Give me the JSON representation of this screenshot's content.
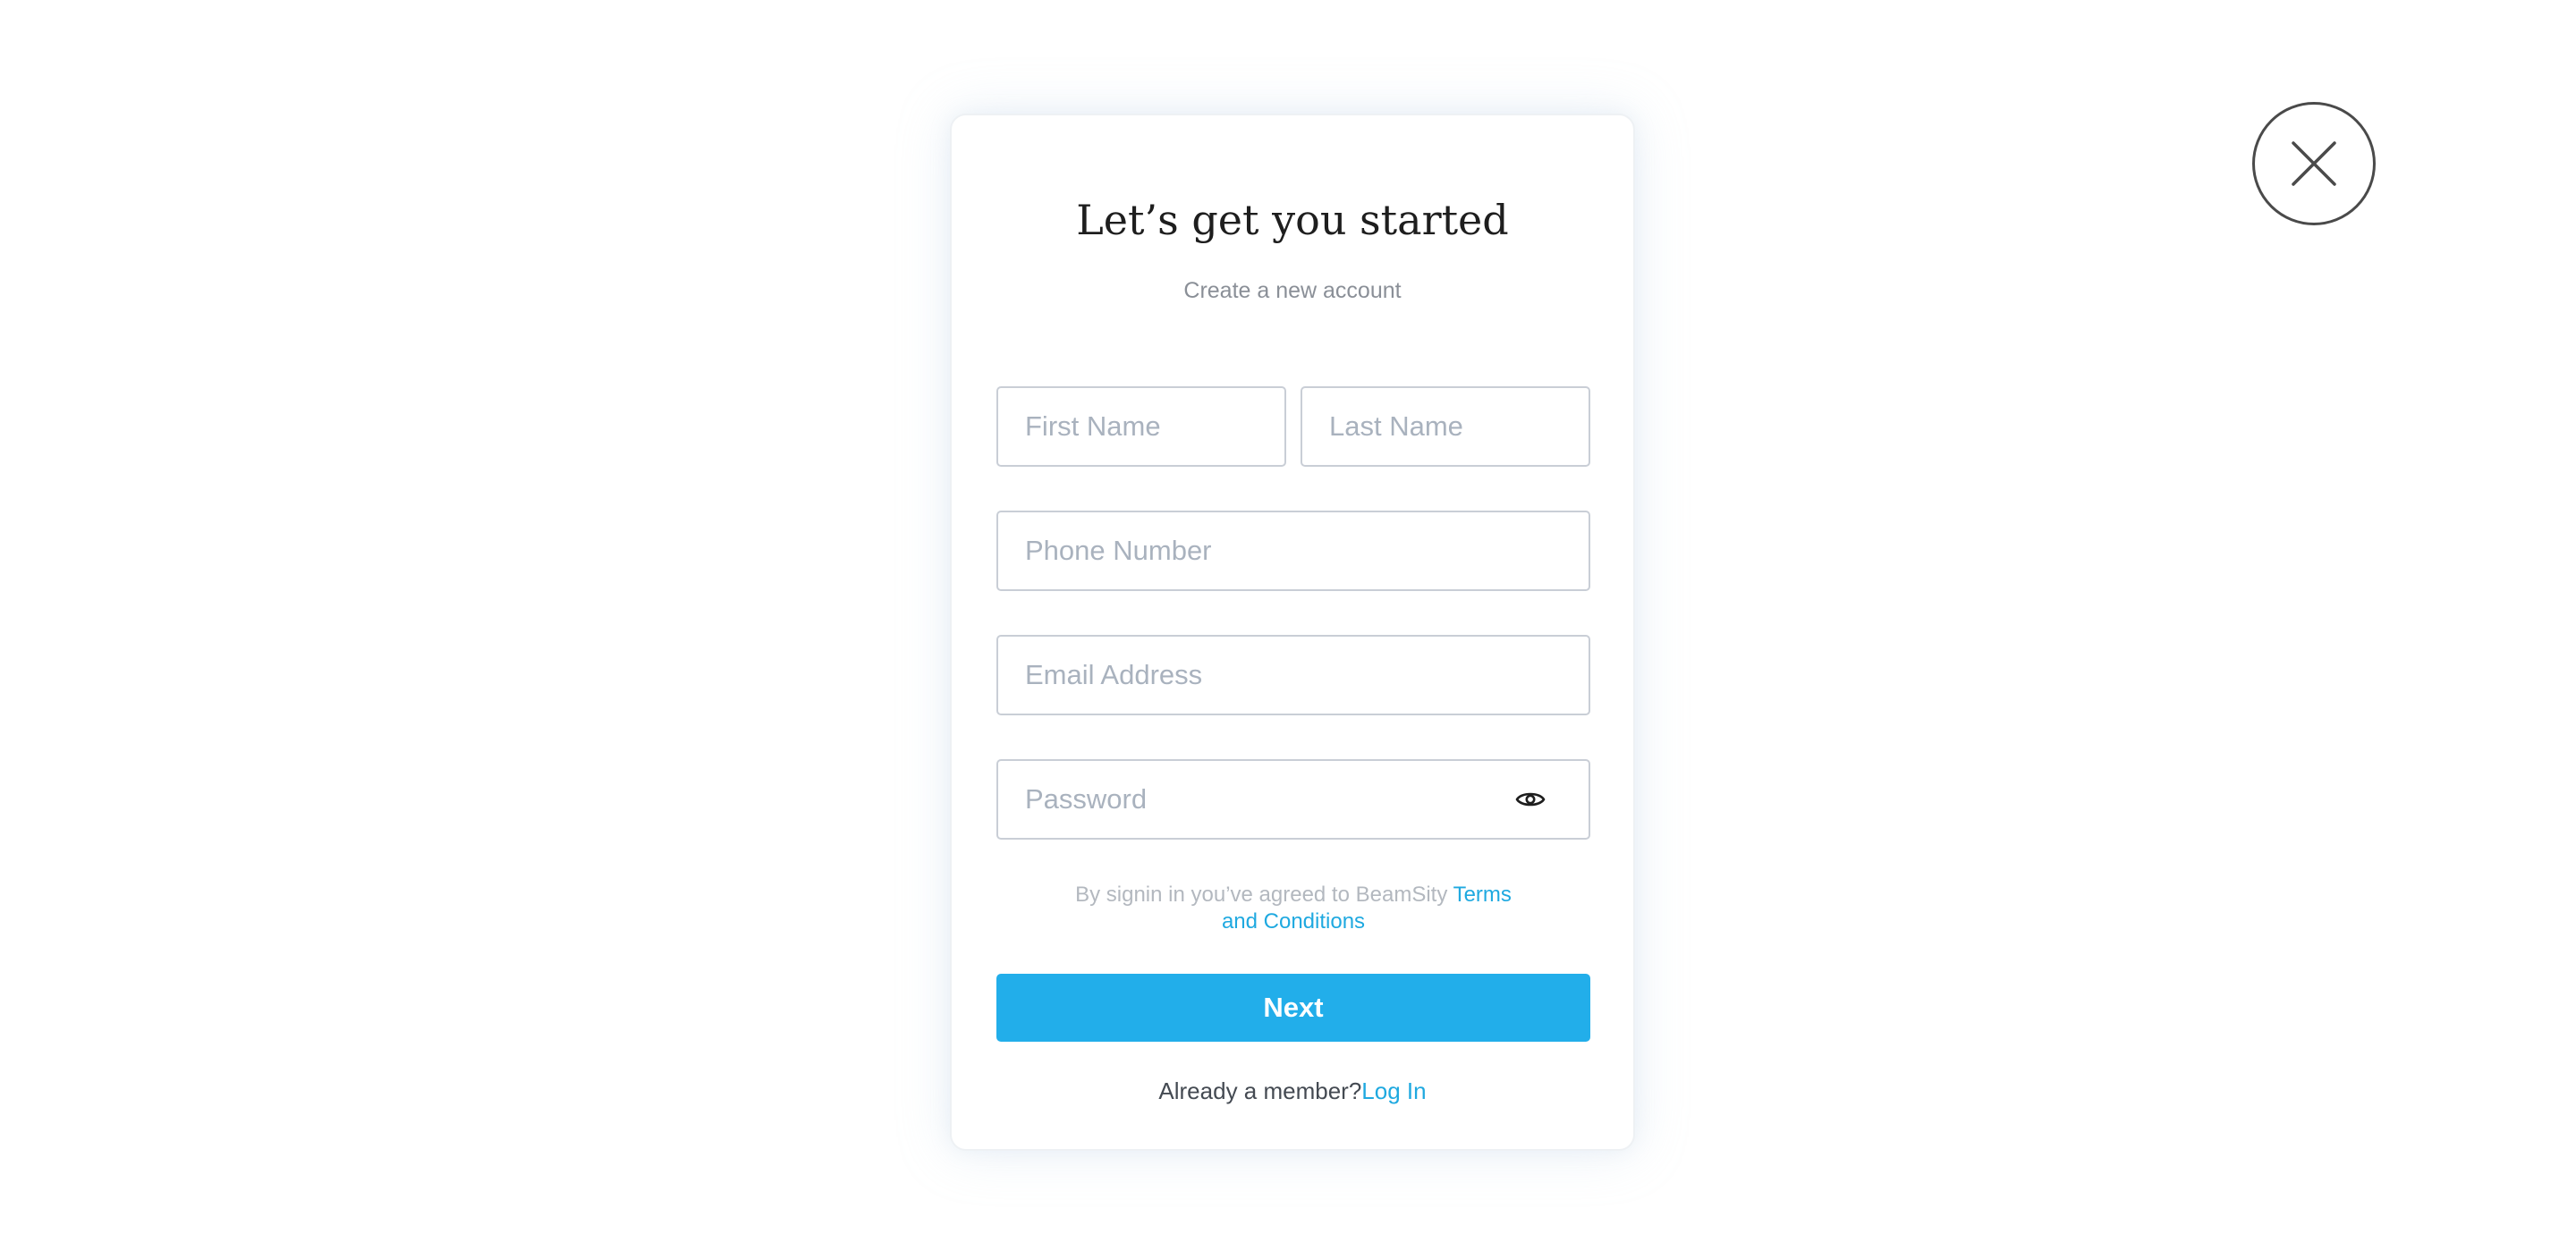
{
  "header": {
    "title": "Let’s get you started",
    "subtitle": "Create a new account"
  },
  "form": {
    "first_name": {
      "placeholder": "First Name",
      "value": ""
    },
    "last_name": {
      "placeholder": "Last Name",
      "value": ""
    },
    "phone": {
      "placeholder": "Phone Number",
      "value": ""
    },
    "email": {
      "placeholder": "Email Address",
      "value": ""
    },
    "password": {
      "placeholder": "Password",
      "value": "",
      "toggle_icon": "eye-icon"
    }
  },
  "terms": {
    "prefix": "By signin in you’ve agreed to BeamSity ",
    "link_label": "Terms and Conditions"
  },
  "actions": {
    "next_label": "Next"
  },
  "footer": {
    "prompt": "Already a member?",
    "login_label": "Log In"
  },
  "close": {
    "icon": "close-icon"
  },
  "colors": {
    "accent": "#22aeea",
    "link": "#1fa9e0",
    "input_border": "#c9ced6",
    "placeholder": "#a9b2be",
    "title": "#1e1e1e",
    "muted": "#8a8f97"
  }
}
